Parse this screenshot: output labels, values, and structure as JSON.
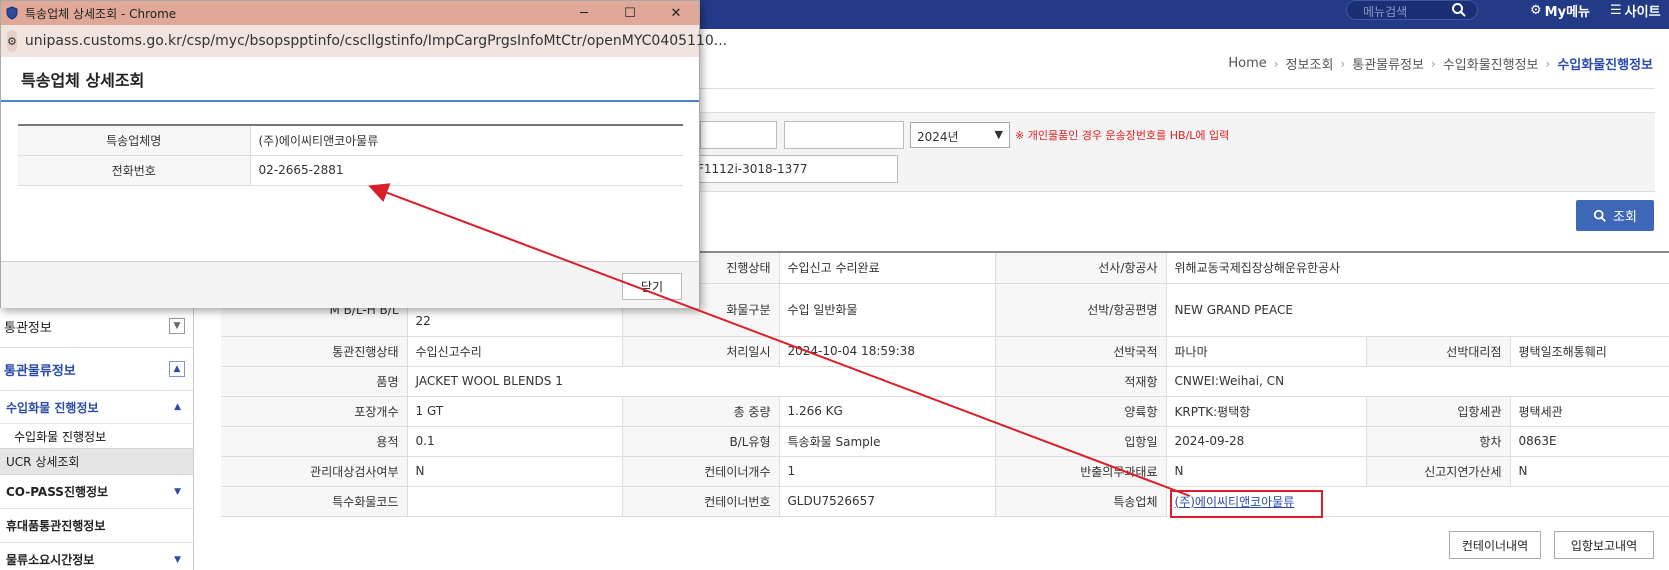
{
  "header": {
    "search_placeholder": "메뉴검색",
    "mymenu": "My메뉴",
    "sitemap": "사이트"
  },
  "breadcrumb": {
    "items": [
      "Home",
      "정보조회",
      "통관물류정보",
      "수입화물진행정보"
    ],
    "current": "수입화물진행정보"
  },
  "search_panel": {
    "year": "2024년",
    "warning": "※ 개인물품인 경우 운송장번호를 HB/L에 입력",
    "bl_value": "F1112i-3018-1377",
    "search_button": "조회"
  },
  "leftnav": {
    "items": [
      {
        "label": "통관정보",
        "toggle": "▼"
      },
      {
        "label": "통관물류정보",
        "toggle": "▲"
      }
    ],
    "sub_active": "수입화물 진행정보",
    "sub_leaf": "수입화물 진행정보",
    "ucr": "UCR 상세조회",
    "copass": "CO-PASS진행정보",
    "portable": "휴대품통관진행정보",
    "logistics": "물류소요시간정보"
  },
  "detail": {
    "rows": [
      [
        "",
        "",
        "진행상태",
        "수입신고 수리완료",
        "선사/항공사",
        "위해교동국제집장상해운유한공사",
        "",
        ""
      ],
      [
        "M B/L-H B/L",
        "22",
        "화물구분",
        "수입 일반화물",
        "선박/항공편명",
        "NEW GRAND PEACE",
        "",
        ""
      ],
      [
        "통관진행상태",
        "수입신고수리",
        "처리일시",
        "2024-10-04 18:59:38",
        "선박국적",
        "파나마",
        "선박대리점",
        "평택일조해통훼리"
      ],
      [
        "품명",
        "JACKET WOOL BLENDS 1",
        "",
        "",
        "적재항",
        "CNWEI:Weihai, CN",
        "",
        ""
      ],
      [
        "포장개수",
        "1 GT",
        "총 중량",
        "1.266 KG",
        "양륙항",
        "KRPTK:평택항",
        "입항세관",
        "평택세관"
      ],
      [
        "용적",
        "0.1",
        "B/L유형",
        "특송화물 Sample",
        "입항일",
        "2024-09-28",
        "항차",
        "0863E"
      ],
      [
        "관리대상검사여부",
        "N",
        "컨테이너개수",
        "1",
        "반출의무과태료",
        "N",
        "신고지연가산세",
        "N"
      ],
      [
        "특수화물코드",
        "",
        "컨테이너번호",
        "GLDU7526657",
        "특송업체",
        "(주)에이씨티앤코아물류",
        "",
        ""
      ]
    ],
    "buttons": {
      "container": "컨테이너내역",
      "arrival": "입항보고내역"
    }
  },
  "popup": {
    "window_title": "특송업체 상세조회 - Chrome",
    "url": "unipass.customs.go.kr/csp/myc/bsopspptinfo/cscllgstinfo/ImpCargPrgsInfoMtCtr/openMYC0405110...",
    "heading": "특송업체 상세조회",
    "rows": [
      {
        "label": "특송업체명",
        "value": "(주)에이씨티앤코아물류"
      },
      {
        "label": "전화번호",
        "value": "02-2665-2881"
      }
    ],
    "close_button": "닫기"
  },
  "colors": {
    "header_bg": "#233a86",
    "accent_blue": "#2a4ca8",
    "highlight_red": "#d9202a",
    "popup_titlebar": "#e0a898"
  }
}
